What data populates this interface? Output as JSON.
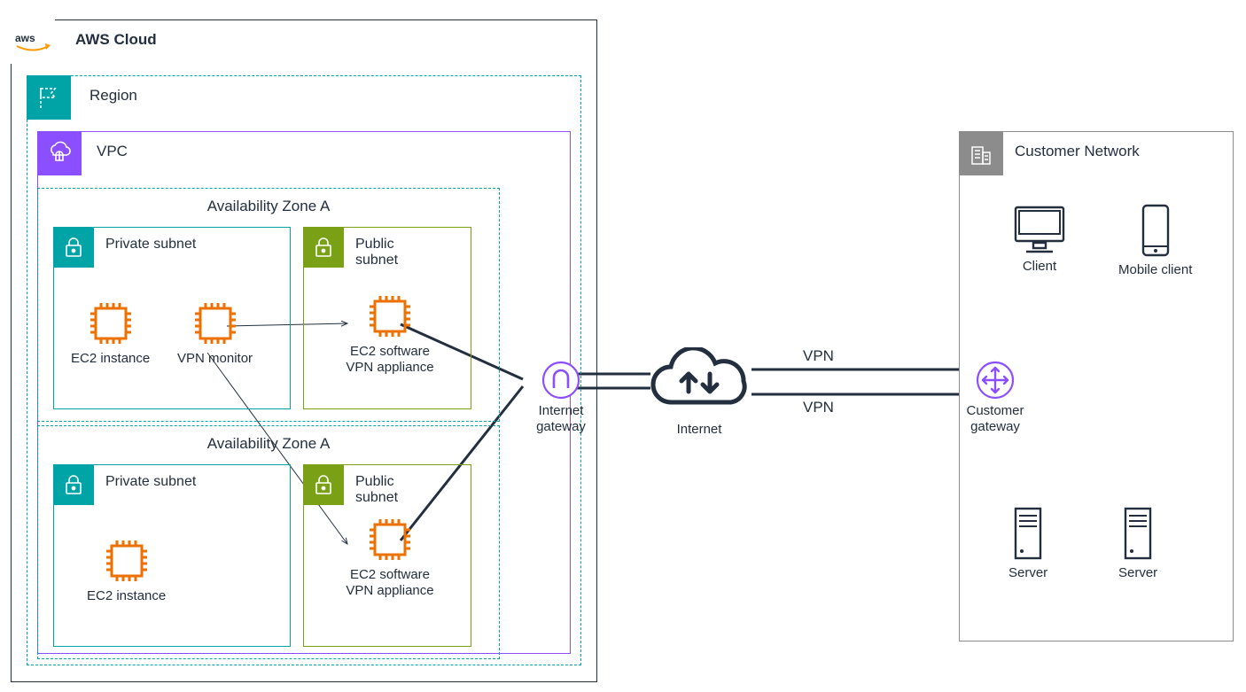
{
  "aws": {
    "title": "AWS Cloud"
  },
  "region": {
    "title": "Region"
  },
  "vpc": {
    "title": "VPC"
  },
  "azA": {
    "title": "Availability Zone A"
  },
  "azB": {
    "title": "Availability Zone A"
  },
  "privateSubnet": {
    "title": "Private subnet"
  },
  "publicSubnet": {
    "title": "Public\nsubnet"
  },
  "ec2Instance": {
    "label": "EC2 instance"
  },
  "vpnMonitor": {
    "label": "VPN monitor"
  },
  "ec2Software": {
    "label": "EC2 software\nVPN appliance"
  },
  "igw": {
    "label": "Internet\ngateway"
  },
  "internet": {
    "label": "Internet"
  },
  "vpnLabel": "VPN",
  "cgw": {
    "label": "Customer\ngateway"
  },
  "customerNetwork": {
    "title": "Customer Network"
  },
  "client": {
    "label": "Client"
  },
  "mobileClient": {
    "label": "Mobile client"
  },
  "server": {
    "label": "Server"
  }
}
